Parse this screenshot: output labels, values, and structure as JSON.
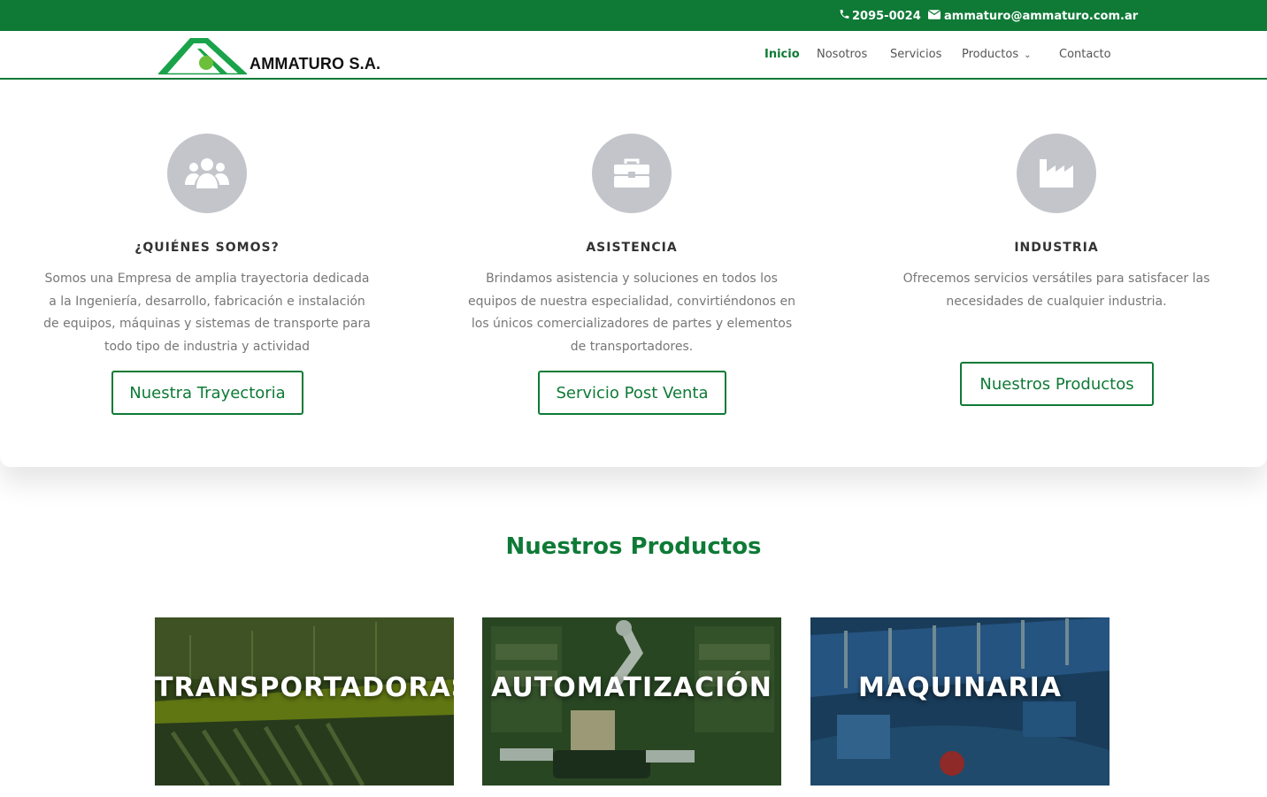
{
  "topbar": {
    "phone": "2095-0024",
    "email": "ammaturo@ammaturo.com.ar"
  },
  "header": {
    "logo_text": "AMMATURO S.A.",
    "nav": [
      {
        "label": "Inicio",
        "active": true
      },
      {
        "label": "Nosotros",
        "active": false
      },
      {
        "label": "Servicios",
        "active": false
      },
      {
        "label": "Productos",
        "active": false,
        "has_dropdown": true
      },
      {
        "label": "Contacto",
        "active": false
      }
    ]
  },
  "features": [
    {
      "icon": "users-icon",
      "title": "¿QUIÉNES SOMOS?",
      "text": "Somos una Empresa de amplia trayectoria dedicada a la Ingeniería, desarrollo, fabricación e instalación de equipos, máquinas y sistemas de transporte para todo tipo de industria y actividad",
      "button": "Nuestra Trayectoria"
    },
    {
      "icon": "briefcase-icon",
      "title": "ASISTENCIA",
      "text": "Brindamos asistencia y soluciones en todos los equipos de nuestra especialidad, convirtiéndonos en los únicos comercializadores de partes y elementos de transportadores.",
      "button": "Servicio Post Venta"
    },
    {
      "icon": "factory-icon",
      "title": "INDUSTRIA",
      "text": "Ofrecemos servicios versátiles para satisfacer las necesidades de cualquier industria.",
      "button": "Nuestros Productos"
    }
  ],
  "products": {
    "title": "Nuestros Productos",
    "cards": [
      {
        "label": "TRANSPORTADORAS"
      },
      {
        "label": "AUTOMATIZACIÓN"
      },
      {
        "label": "MAQUINARIA"
      }
    ]
  },
  "colors": {
    "brand_green": "#0e7a36",
    "icon_circle": "#c3c5cb"
  }
}
